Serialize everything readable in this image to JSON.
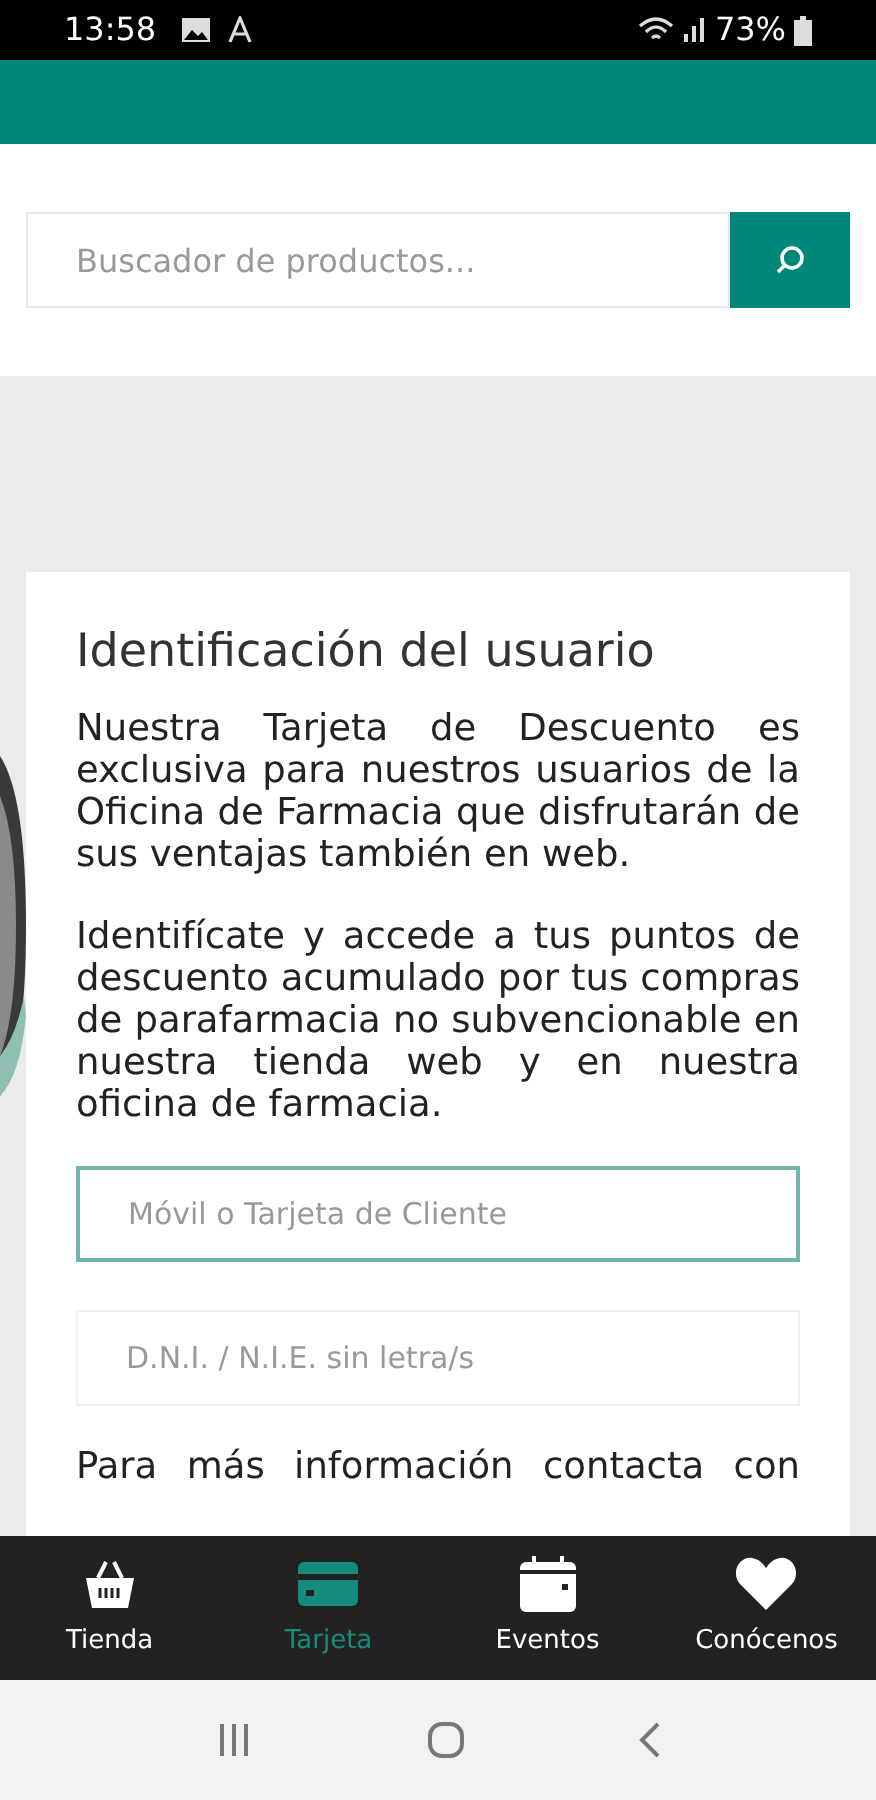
{
  "status_bar": {
    "time": "13:58",
    "battery": "73%"
  },
  "search": {
    "placeholder": "Buscador de productos..."
  },
  "card": {
    "title": "Identificación del usuario",
    "paragraphs": [
      "Nuestra Tarjeta de Descuento es exclusiva para nuestros usuarios de la Oficina de Farmacia que disfrutarán de sus ventajas también en web.",
      "Identifícate y accede a tus puntos de descuento acumulado por tus compras de parafarmacia no subvencionable en nuestra tienda web y en nuestra oficina de farmacia."
    ],
    "fields": [
      {
        "placeholder": "Móvil o Tarjeta de Cliente",
        "focused": true
      },
      {
        "placeholder": "D.N.I. / N.I.E. sin letra/s",
        "focused": false
      }
    ],
    "footer_text": "Para más información contacta con"
  },
  "tabs": [
    {
      "label": "Tienda",
      "kind": "basket",
      "selected": false
    },
    {
      "label": "Tarjeta",
      "kind": "card",
      "selected": true
    },
    {
      "label": "Eventos",
      "kind": "calendar",
      "selected": false
    },
    {
      "label": "Conócenos",
      "kind": "heart",
      "selected": false
    }
  ]
}
